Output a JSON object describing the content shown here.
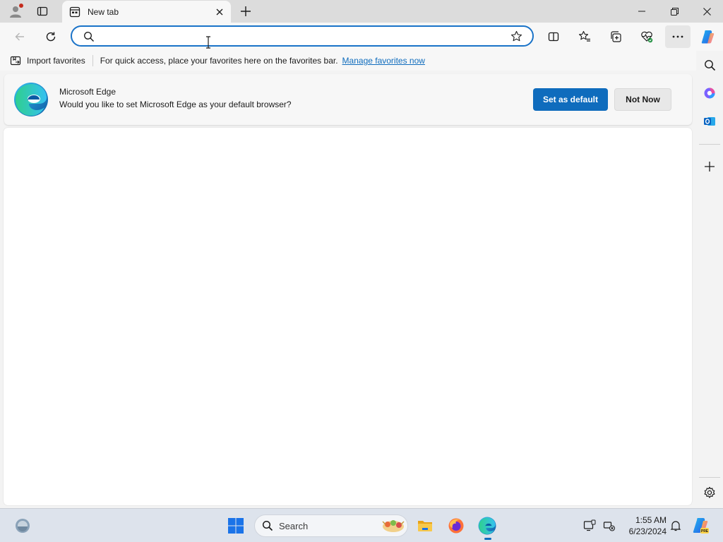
{
  "tab": {
    "title": "New tab"
  },
  "address_bar": {
    "value": "",
    "placeholder": ""
  },
  "favorites_bar": {
    "import_label": "Import favorites",
    "hint_text": "For quick access, place your favorites here on the favorites bar.",
    "manage_link": "Manage favorites now"
  },
  "banner": {
    "title": "Microsoft Edge",
    "message": "Would you like to set Microsoft Edge as your default browser?",
    "primary_button": "Set as default",
    "secondary_button": "Not Now"
  },
  "taskbar": {
    "search_label": "Search",
    "time": "1:55 AM",
    "date": "6/23/2024"
  },
  "colors": {
    "accent": "#0f6cbd",
    "address_border": "#1a73c8",
    "profile_badge": "#c42b1c"
  },
  "icons": {
    "toolbar": [
      "back-icon",
      "refresh-icon",
      "search-icon",
      "favorite-star-icon",
      "split-screen-icon",
      "favorites-icon",
      "collections-icon",
      "browser-essentials-icon",
      "more-icon",
      "copilot-icon"
    ],
    "sidebar": [
      "search-icon",
      "office-icon",
      "outlook-icon",
      "add-icon",
      "settings-icon"
    ],
    "taskbar": [
      "widgets-icon",
      "start-icon",
      "file-explorer-icon",
      "firefox-icon",
      "edge-icon",
      "display-icon",
      "network-icon",
      "notification-icon",
      "copilot-pre-icon"
    ]
  }
}
